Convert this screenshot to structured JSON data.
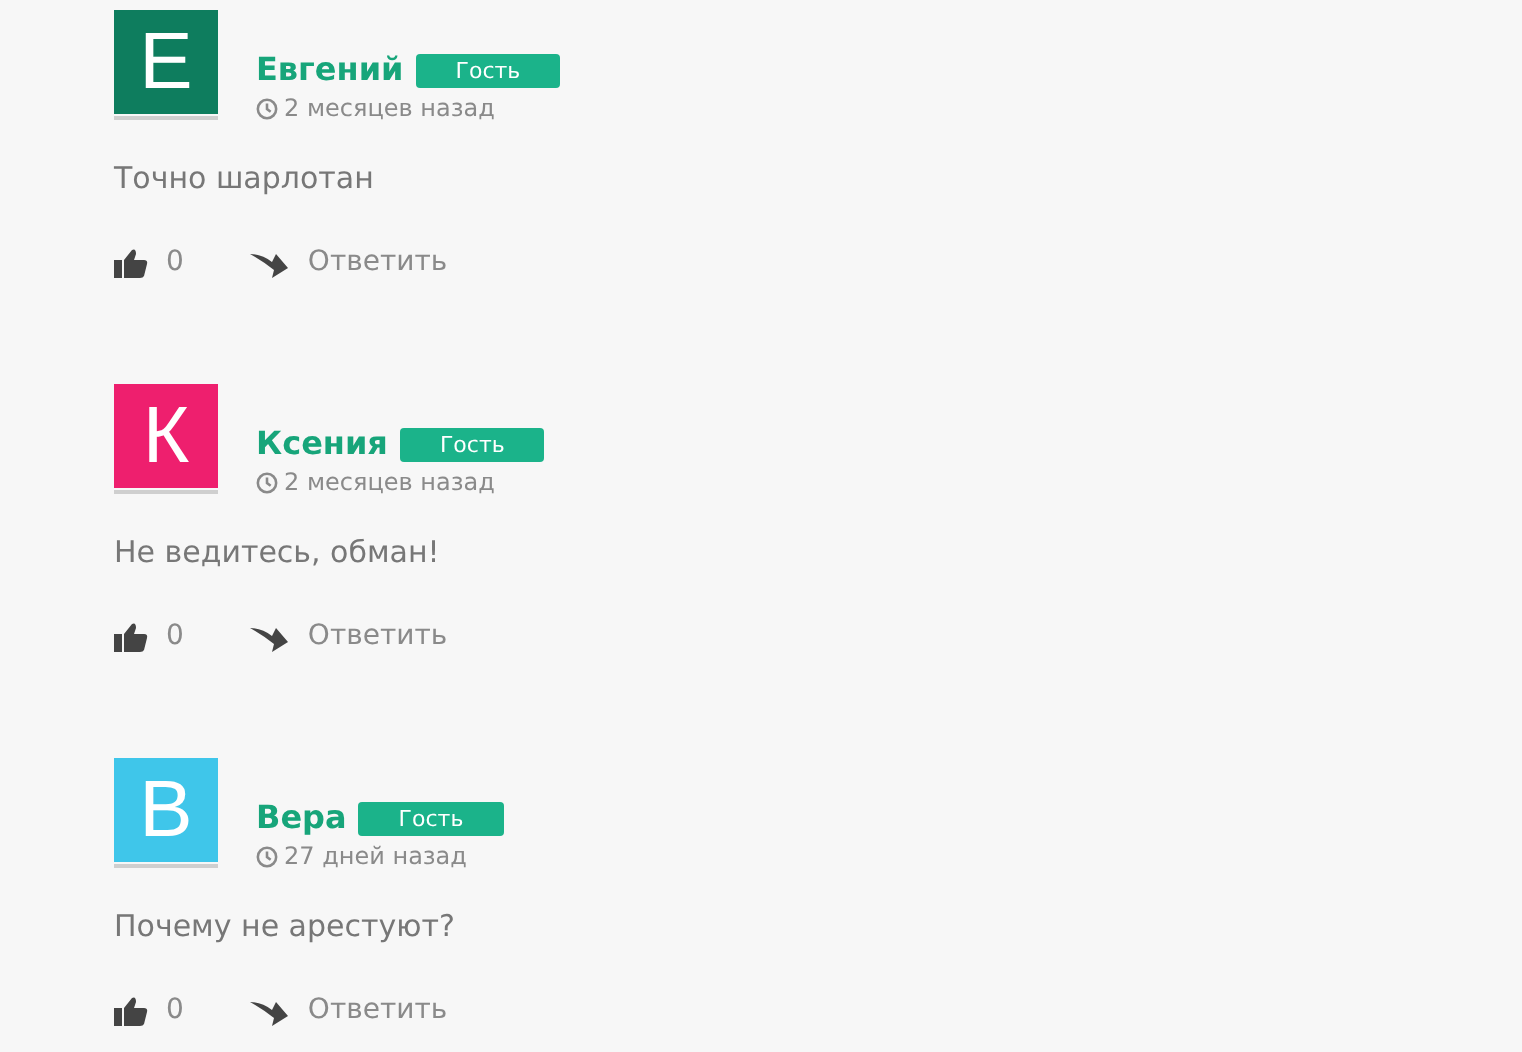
{
  "comments": [
    {
      "avatar_letter": "Е",
      "color": "#0e7d5e",
      "author": "Евгений",
      "badge": "Гость",
      "time": "2 месяцев назад",
      "text": "Точно шарлотан",
      "likes": "0",
      "reply": "Ответить"
    },
    {
      "avatar_letter": "К",
      "color": "#ee1f6e",
      "author": "Ксения",
      "badge": "Гость",
      "time": "2 месяцев назад",
      "text": "Не ведитесь, обман!",
      "likes": "0",
      "reply": "Ответить"
    },
    {
      "avatar_letter": "В",
      "color": "#3fc6ea",
      "author": "Вера",
      "badge": "Гость",
      "time": "27 дней назад",
      "text": "Почему не арестуют?",
      "likes": "0",
      "reply": "Ответить"
    }
  ]
}
